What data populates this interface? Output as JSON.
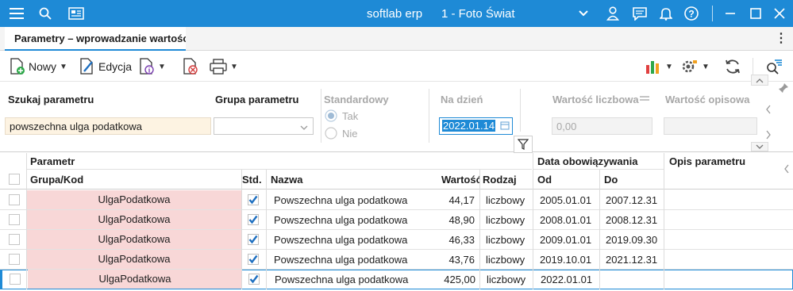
{
  "titlebar": {
    "app_name": "softlab erp",
    "company": "1 - Foto Świat",
    "icons": [
      "menu-icon",
      "search-icon",
      "newspaper-icon",
      "chevron-down-icon",
      "user-icon",
      "chat-icon",
      "bell-icon",
      "help-icon",
      "minimize-icon",
      "maximize-icon",
      "close-icon"
    ],
    "accent": "#1e8ad6"
  },
  "tab": {
    "label": "Parametry – wprowadzanie wartości"
  },
  "toolbar": {
    "new_label": "Nowy",
    "edit_label": "Edycja"
  },
  "filters": {
    "search_label": "Szukaj parametru",
    "search_value": "powszechna ulga podatkowa",
    "group_label": "Grupa parametru",
    "group_value": "",
    "standard_label": "Standardowy",
    "standard_yes": "Tak",
    "standard_no": "Nie",
    "date_label": "Na dzień",
    "date_value": "2022.01.14",
    "numeric_label": "Wartość liczbowa",
    "numeric_value": "0,00",
    "descr_label": "Wartość opisowa",
    "descr_value": ""
  },
  "grid": {
    "header": {
      "parametr": "Parametr",
      "grupa_kod": "Grupa/Kod",
      "std": "Std.",
      "nazwa": "Nazwa",
      "wartosc": "Wartość",
      "rodzaj": "Rodzaj",
      "data_obow": "Data obowiązywania",
      "od": "Od",
      "do": "Do",
      "opis": "Opis parametru"
    },
    "rows": [
      {
        "kod": "UlgaPodatkowa",
        "nazwa": "Powszechna ulga podatkowa",
        "wartosc": "44,17",
        "rodzaj": "liczbowy",
        "od": "2005.01.01",
        "do": "2007.12.31",
        "opis": ""
      },
      {
        "kod": "UlgaPodatkowa",
        "nazwa": "Powszechna ulga podatkowa",
        "wartosc": "48,90",
        "rodzaj": "liczbowy",
        "od": "2008.01.01",
        "do": "2008.12.31",
        "opis": ""
      },
      {
        "kod": "UlgaPodatkowa",
        "nazwa": "Powszechna ulga podatkowa",
        "wartosc": "46,33",
        "rodzaj": "liczbowy",
        "od": "2009.01.01",
        "do": "2019.09.30",
        "opis": ""
      },
      {
        "kod": "UlgaPodatkowa",
        "nazwa": "Powszechna ulga podatkowa",
        "wartosc": "43,76",
        "rodzaj": "liczbowy",
        "od": "2019.10.01",
        "do": "2021.12.31",
        "opis": ""
      },
      {
        "kod": "UlgaPodatkowa",
        "nazwa": "Powszechna ulga podatkowa",
        "wartosc": "425,00",
        "rodzaj": "liczbowy",
        "od": "2022.01.01",
        "do": "",
        "opis": ""
      }
    ]
  }
}
